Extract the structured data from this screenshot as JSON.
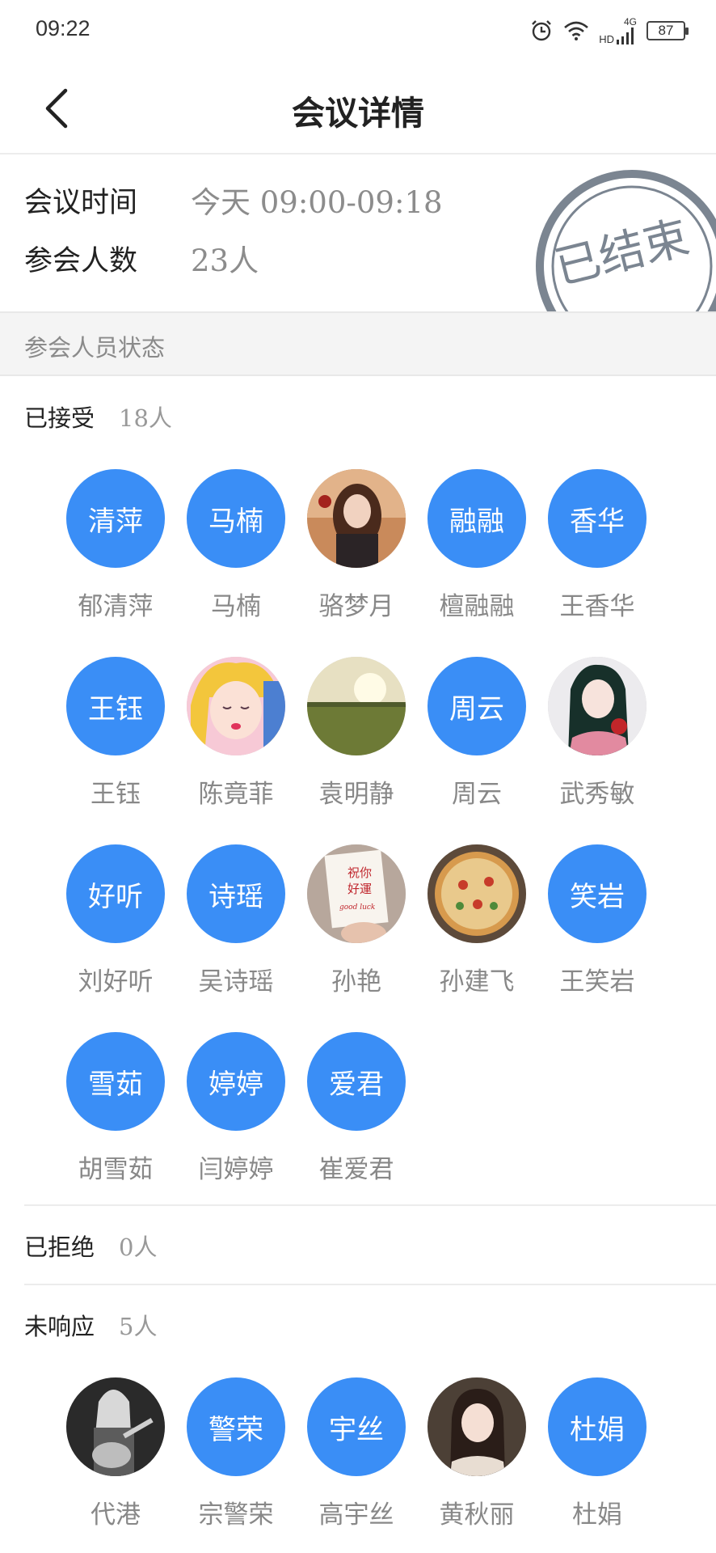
{
  "status": {
    "time": "09:22",
    "battery": "87",
    "network": "4G",
    "hd": "HD"
  },
  "header": {
    "title": "会议详情"
  },
  "info": {
    "time_label": "会议时间",
    "time_value": "今天 09:00-09:18",
    "count_label": "参会人数",
    "count_value": "23人",
    "stamp_text": "已结束"
  },
  "section": {
    "title": "参会人员状态"
  },
  "accepted": {
    "label": "已接受",
    "count": "18人",
    "people": [
      {
        "name": "郁清萍",
        "avatar_text": "清萍"
      },
      {
        "name": "马楠",
        "avatar_text": "马楠"
      },
      {
        "name": "骆梦月",
        "avatar_text": "",
        "photo": "portrait-photo"
      },
      {
        "name": "檀融融",
        "avatar_text": "融融"
      },
      {
        "name": "王香华",
        "avatar_text": "香华"
      },
      {
        "name": "王钰",
        "avatar_text": "王钰"
      },
      {
        "name": "陈竟菲",
        "avatar_text": "",
        "photo": "anime-photo"
      },
      {
        "name": "袁明静",
        "avatar_text": "",
        "photo": "field-photo"
      },
      {
        "name": "周云",
        "avatar_text": "周云"
      },
      {
        "name": "武秀敏",
        "avatar_text": "",
        "photo": "illustration-photo"
      },
      {
        "name": "刘好听",
        "avatar_text": "好听"
      },
      {
        "name": "吴诗瑶",
        "avatar_text": "诗瑶"
      },
      {
        "name": "孙艳",
        "avatar_text": "",
        "photo": "card-photo"
      },
      {
        "name": "孙建飞",
        "avatar_text": "",
        "photo": "pizza-photo"
      },
      {
        "name": "王笑岩",
        "avatar_text": "笑岩"
      },
      {
        "name": "胡雪茹",
        "avatar_text": "雪茹"
      },
      {
        "name": "闫婷婷",
        "avatar_text": "婷婷"
      },
      {
        "name": "崔爱君",
        "avatar_text": "爱君"
      }
    ]
  },
  "rejected": {
    "label": "已拒绝",
    "count": "0人"
  },
  "no_response": {
    "label": "未响应",
    "count": "5人",
    "people": [
      {
        "name": "代港",
        "avatar_text": "",
        "photo": "guitar-photo"
      },
      {
        "name": "宗警荣",
        "avatar_text": "警荣"
      },
      {
        "name": "高宇丝",
        "avatar_text": "宇丝"
      },
      {
        "name": "黄秋丽",
        "avatar_text": "",
        "photo": "girl-photo"
      },
      {
        "name": "杜娟",
        "avatar_text": "杜娟"
      }
    ]
  },
  "colors": {
    "avatar_blue": "#3a8ef6",
    "stamp_gray": "#7b8591"
  },
  "photo_art": {
    "card_text_1": "祝你",
    "card_text_2": "好運",
    "card_text_3": "good luck"
  }
}
